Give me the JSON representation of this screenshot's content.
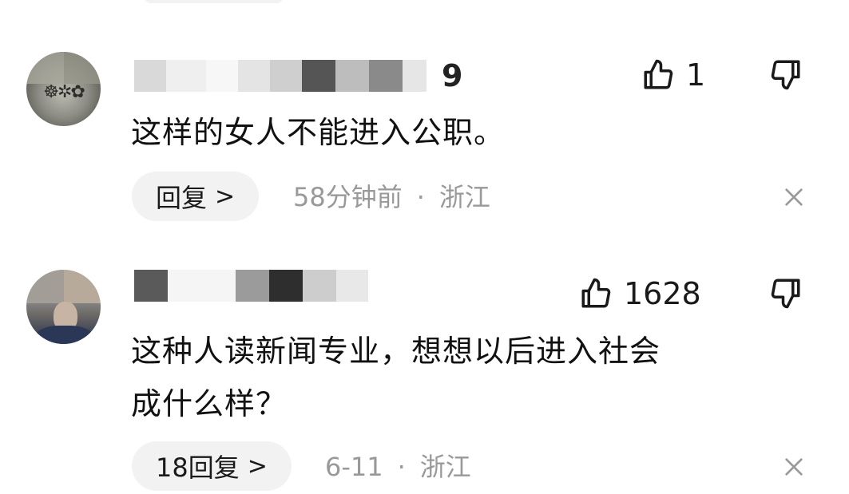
{
  "comments": [
    {
      "username_visible_tail": "9",
      "text": "这样的女人不能进入公职。",
      "like_count": "1",
      "reply_label": "回复",
      "reply_chevron": ">",
      "time": "58分钟前",
      "separator": "·",
      "location": "浙江",
      "icons": {
        "like": "thumbs-up-icon",
        "dislike": "thumbs-down-icon",
        "close": "close-icon"
      }
    },
    {
      "username_visible_tail": "",
      "text_line1": "这种人读新闻专业，想想以后进入社会",
      "text_line2": "成什么样？",
      "like_count": "1628",
      "reply_label": "18回复",
      "reply_chevron": ">",
      "time": "6-11",
      "separator": "·",
      "location": "浙江",
      "icons": {
        "like": "thumbs-up-icon",
        "dislike": "thumbs-down-icon",
        "close": "close-icon"
      }
    }
  ],
  "colors": {
    "text": "#111111",
    "meta": "#999999",
    "pill_bg": "#f2f2f2",
    "icon": "#1a1a1a"
  }
}
